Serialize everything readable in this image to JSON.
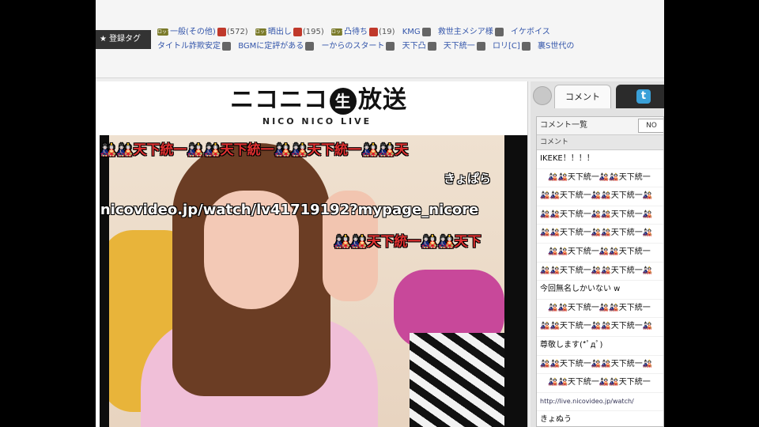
{
  "tags": {
    "header_label": "登録タグ",
    "row1": [
      {
        "lock": "ロック",
        "name": "一般(その他)",
        "count": "(572)",
        "edit": "red"
      },
      {
        "lock": "ロック",
        "name": "晒出し",
        "count": "(195)",
        "edit": "red"
      },
      {
        "lock": "ロック",
        "name": "凸待ち",
        "count": "(19)",
        "edit": "red"
      },
      {
        "lock": "",
        "name": "KMG",
        "count": "",
        "edit": "gray"
      },
      {
        "lock": "",
        "name": "救世主メシア様",
        "count": "",
        "edit": "gray"
      },
      {
        "lock": "",
        "name": "イケボイス",
        "count": "",
        "edit": ""
      }
    ],
    "row2": [
      {
        "name": "タイトル詐欺安定",
        "edit": "gray"
      },
      {
        "name": "BGMに定評がある",
        "edit": "gray"
      },
      {
        "name": "ーからのスタート",
        "edit": "gray"
      },
      {
        "name": "天下凸",
        "edit": "gray"
      },
      {
        "name": "天下統一",
        "edit": "gray"
      },
      {
        "name": "ロリ[C]",
        "edit": "gray"
      },
      {
        "name": "裏S世代の",
        "edit": ""
      }
    ]
  },
  "player": {
    "logo_main_left": "ニコニコ",
    "logo_nama": "生",
    "logo_main_right": "放送",
    "logo_sub": "NICO NICO LIVE",
    "comments": [
      "🎎🎎天下統一🎎🎎天下統一🎎🎎天下統一🎎🎎天",
      "きょぱら",
      ".nicovideo.jp/watch/lv41719192?mypage_nicore",
      "🎎🎎天下統一🎎🎎天下"
    ]
  },
  "comment_panel": {
    "tab_comment": "コメント",
    "tab_twitter": "t",
    "list_title": "コメント一覧",
    "select_value": "NO",
    "column_header": "コメント",
    "items": [
      "IKEKE！！！！",
      "　🎎🎎天下統一🎎🎎天下統一",
      "🎎🎎天下統一🎎🎎天下統一🎎",
      "🎎🎎天下統一🎎🎎天下統一🎎",
      "🎎🎎天下統一🎎🎎天下統一🎎",
      "　🎎🎎天下統一🎎🎎天下統一",
      "🎎🎎天下統一🎎🎎天下統一🎎",
      "今回無名しかいない w",
      "　🎎🎎天下統一🎎🎎天下統一",
      "🎎🎎天下統一🎎🎎天下統一🎎",
      "尊敬します(*ﾟдﾟ)",
      "🎎🎎天下統一🎎🎎天下統一🎎",
      "　🎎🎎天下統一🎎🎎天下統一",
      "http://live.nicovideo.jp/watch/",
      "きょぬう"
    ]
  }
}
